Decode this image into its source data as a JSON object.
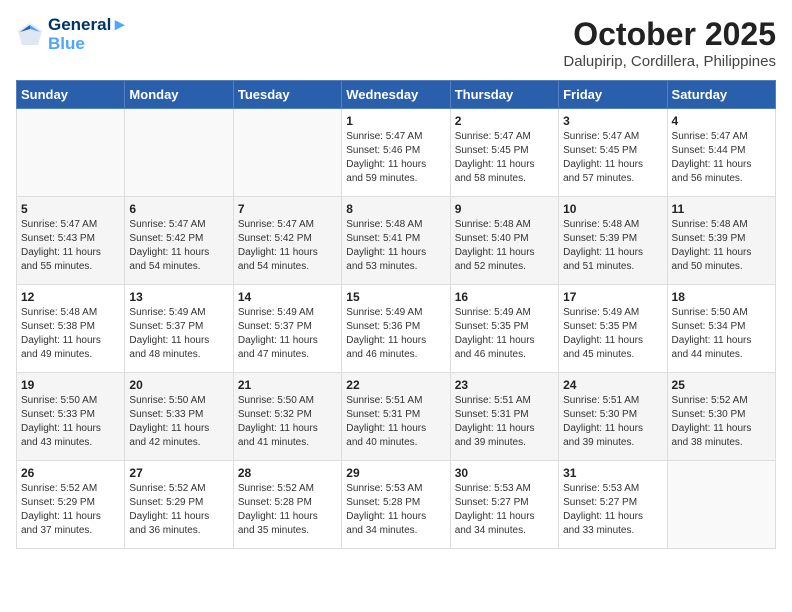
{
  "header": {
    "logo_line1": "General",
    "logo_line2": "Blue",
    "month": "October 2025",
    "location": "Dalupirip, Cordillera, Philippines"
  },
  "days_of_week": [
    "Sunday",
    "Monday",
    "Tuesday",
    "Wednesday",
    "Thursday",
    "Friday",
    "Saturday"
  ],
  "weeks": [
    [
      {
        "day": "",
        "content": ""
      },
      {
        "day": "",
        "content": ""
      },
      {
        "day": "",
        "content": ""
      },
      {
        "day": "1",
        "content": "Sunrise: 5:47 AM\nSunset: 5:46 PM\nDaylight: 11 hours\nand 59 minutes."
      },
      {
        "day": "2",
        "content": "Sunrise: 5:47 AM\nSunset: 5:45 PM\nDaylight: 11 hours\nand 58 minutes."
      },
      {
        "day": "3",
        "content": "Sunrise: 5:47 AM\nSunset: 5:45 PM\nDaylight: 11 hours\nand 57 minutes."
      },
      {
        "day": "4",
        "content": "Sunrise: 5:47 AM\nSunset: 5:44 PM\nDaylight: 11 hours\nand 56 minutes."
      }
    ],
    [
      {
        "day": "5",
        "content": "Sunrise: 5:47 AM\nSunset: 5:43 PM\nDaylight: 11 hours\nand 55 minutes."
      },
      {
        "day": "6",
        "content": "Sunrise: 5:47 AM\nSunset: 5:42 PM\nDaylight: 11 hours\nand 54 minutes."
      },
      {
        "day": "7",
        "content": "Sunrise: 5:47 AM\nSunset: 5:42 PM\nDaylight: 11 hours\nand 54 minutes."
      },
      {
        "day": "8",
        "content": "Sunrise: 5:48 AM\nSunset: 5:41 PM\nDaylight: 11 hours\nand 53 minutes."
      },
      {
        "day": "9",
        "content": "Sunrise: 5:48 AM\nSunset: 5:40 PM\nDaylight: 11 hours\nand 52 minutes."
      },
      {
        "day": "10",
        "content": "Sunrise: 5:48 AM\nSunset: 5:39 PM\nDaylight: 11 hours\nand 51 minutes."
      },
      {
        "day": "11",
        "content": "Sunrise: 5:48 AM\nSunset: 5:39 PM\nDaylight: 11 hours\nand 50 minutes."
      }
    ],
    [
      {
        "day": "12",
        "content": "Sunrise: 5:48 AM\nSunset: 5:38 PM\nDaylight: 11 hours\nand 49 minutes."
      },
      {
        "day": "13",
        "content": "Sunrise: 5:49 AM\nSunset: 5:37 PM\nDaylight: 11 hours\nand 48 minutes."
      },
      {
        "day": "14",
        "content": "Sunrise: 5:49 AM\nSunset: 5:37 PM\nDaylight: 11 hours\nand 47 minutes."
      },
      {
        "day": "15",
        "content": "Sunrise: 5:49 AM\nSunset: 5:36 PM\nDaylight: 11 hours\nand 46 minutes."
      },
      {
        "day": "16",
        "content": "Sunrise: 5:49 AM\nSunset: 5:35 PM\nDaylight: 11 hours\nand 46 minutes."
      },
      {
        "day": "17",
        "content": "Sunrise: 5:49 AM\nSunset: 5:35 PM\nDaylight: 11 hours\nand 45 minutes."
      },
      {
        "day": "18",
        "content": "Sunrise: 5:50 AM\nSunset: 5:34 PM\nDaylight: 11 hours\nand 44 minutes."
      }
    ],
    [
      {
        "day": "19",
        "content": "Sunrise: 5:50 AM\nSunset: 5:33 PM\nDaylight: 11 hours\nand 43 minutes."
      },
      {
        "day": "20",
        "content": "Sunrise: 5:50 AM\nSunset: 5:33 PM\nDaylight: 11 hours\nand 42 minutes."
      },
      {
        "day": "21",
        "content": "Sunrise: 5:50 AM\nSunset: 5:32 PM\nDaylight: 11 hours\nand 41 minutes."
      },
      {
        "day": "22",
        "content": "Sunrise: 5:51 AM\nSunset: 5:31 PM\nDaylight: 11 hours\nand 40 minutes."
      },
      {
        "day": "23",
        "content": "Sunrise: 5:51 AM\nSunset: 5:31 PM\nDaylight: 11 hours\nand 39 minutes."
      },
      {
        "day": "24",
        "content": "Sunrise: 5:51 AM\nSunset: 5:30 PM\nDaylight: 11 hours\nand 39 minutes."
      },
      {
        "day": "25",
        "content": "Sunrise: 5:52 AM\nSunset: 5:30 PM\nDaylight: 11 hours\nand 38 minutes."
      }
    ],
    [
      {
        "day": "26",
        "content": "Sunrise: 5:52 AM\nSunset: 5:29 PM\nDaylight: 11 hours\nand 37 minutes."
      },
      {
        "day": "27",
        "content": "Sunrise: 5:52 AM\nSunset: 5:29 PM\nDaylight: 11 hours\nand 36 minutes."
      },
      {
        "day": "28",
        "content": "Sunrise: 5:52 AM\nSunset: 5:28 PM\nDaylight: 11 hours\nand 35 minutes."
      },
      {
        "day": "29",
        "content": "Sunrise: 5:53 AM\nSunset: 5:28 PM\nDaylight: 11 hours\nand 34 minutes."
      },
      {
        "day": "30",
        "content": "Sunrise: 5:53 AM\nSunset: 5:27 PM\nDaylight: 11 hours\nand 34 minutes."
      },
      {
        "day": "31",
        "content": "Sunrise: 5:53 AM\nSunset: 5:27 PM\nDaylight: 11 hours\nand 33 minutes."
      },
      {
        "day": "",
        "content": ""
      }
    ]
  ]
}
